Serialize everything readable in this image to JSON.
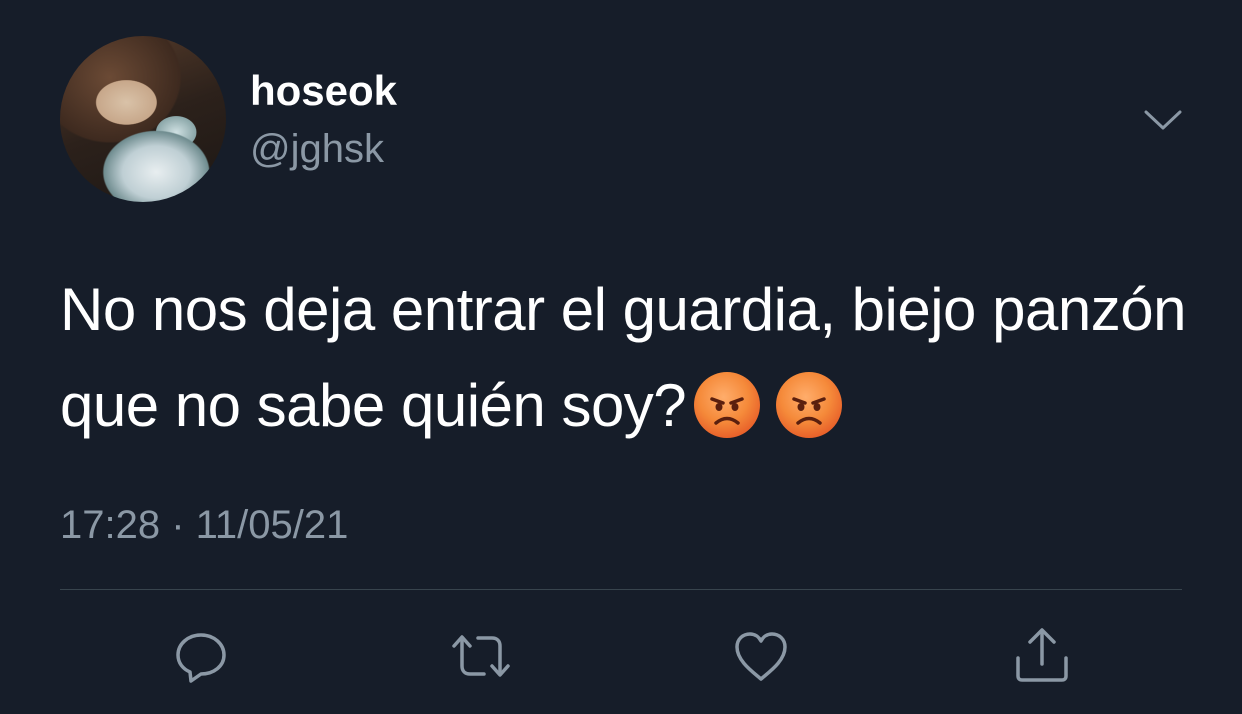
{
  "user": {
    "display_name": "hoseok",
    "handle": "@jghsk"
  },
  "tweet": {
    "text": "No nos deja entrar el guardia, biejo panzón que no sabe quién soy?",
    "emojis": [
      "pouting-face-emoji",
      "pouting-face-emoji"
    ],
    "timestamp": "17:28 · 11/05/21"
  },
  "actions": [
    {
      "name": "reply",
      "icon": "speech-bubble-icon"
    },
    {
      "name": "retweet",
      "icon": "retweet-arrows-icon"
    },
    {
      "name": "like",
      "icon": "heart-icon"
    },
    {
      "name": "share",
      "icon": "share-upload-icon"
    }
  ],
  "colors": {
    "background": "#161d29",
    "text": "#ffffff",
    "secondary_text": "#8b98a5",
    "divider": "#38444d"
  }
}
